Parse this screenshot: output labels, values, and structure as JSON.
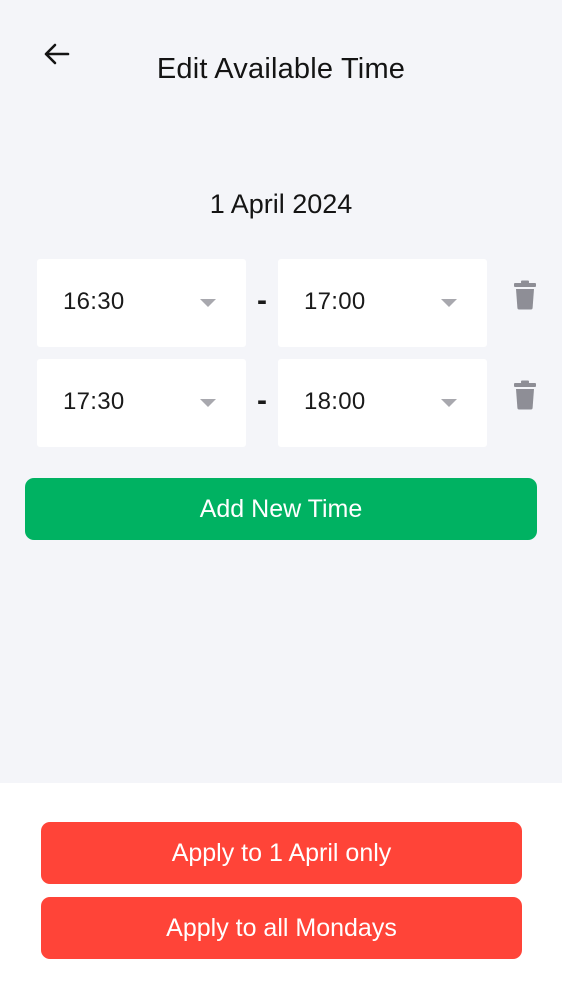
{
  "header": {
    "back_icon": "arrow-left-icon",
    "title": "Edit Available Time"
  },
  "date": "1 April 2024",
  "time_slots": [
    {
      "start": "16:30",
      "separator": "-",
      "end": "17:00",
      "delete_icon": "trash-icon"
    },
    {
      "start": "17:30",
      "separator": "-",
      "end": "18:00",
      "delete_icon": "trash-icon"
    }
  ],
  "add_button_label": "Add New Time",
  "footer": {
    "apply_single_label": "Apply to 1 April only",
    "apply_all_label": "Apply to all Mondays"
  },
  "colors": {
    "background": "#f4f5f9",
    "add_button": "#00b262",
    "apply_button": "#ff4438",
    "trash_icon": "#8e8e96"
  }
}
